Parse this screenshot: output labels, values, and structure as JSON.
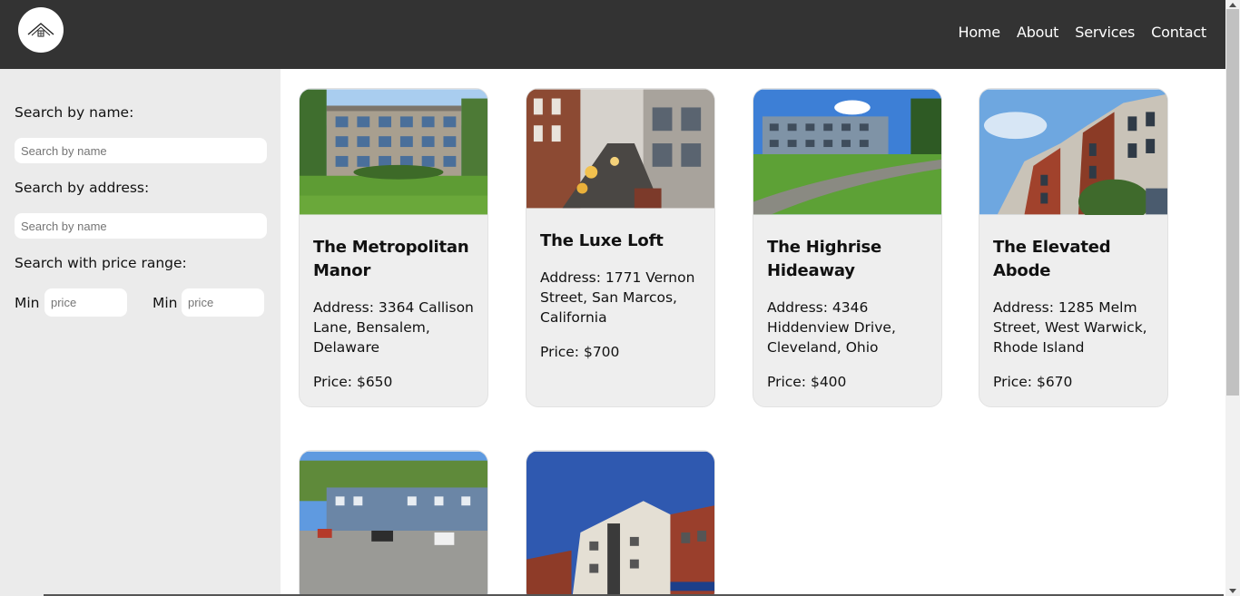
{
  "header": {
    "logo_icon": "house-roof-icon",
    "nav": [
      "Home",
      "About",
      "Services",
      "Contact"
    ]
  },
  "sidebar": {
    "name_label": "Search by name:",
    "name_placeholder": "Search by name",
    "address_label": "Search by address:",
    "address_placeholder": "Search by name",
    "price_label": "Search with price range:",
    "min_label_1": "Min",
    "min_placeholder_1": "price",
    "min_label_2": "Min",
    "min_placeholder_2": "price"
  },
  "listings": [
    {
      "title": "The Metropolitan Manor",
      "address": "Address: 3364 Callison Lane, Bensalem, Delaware",
      "price": "Price: $650",
      "image": "apartment-courtyard-photo"
    },
    {
      "title": "The Luxe Loft",
      "address": "Address: 1771 Vernon Street, San Marcos, California",
      "price": "Price: $700",
      "image": "loft-courtyard-lights-photo"
    },
    {
      "title": "The Highrise Hideaway",
      "address": "Address: 4346 Hiddenview Drive, Cleveland, Ohio",
      "price": "Price: $400",
      "image": "apartment-lawn-path-photo"
    },
    {
      "title": "The Elevated Abode",
      "address": "Address: 1285 Melm Street, West Warwick, Rhode Island",
      "price": "Price: $670",
      "image": "modern-building-sky-photo"
    },
    {
      "title": "",
      "address": "",
      "price": "",
      "image": "apartment-parking-lot-photo"
    },
    {
      "title": "",
      "address": "",
      "price": "",
      "image": "brick-building-fire-escape-photo"
    }
  ],
  "colors": {
    "header_bg": "#333333",
    "sidebar_bg": "#ebebeb",
    "card_bg": "#eeeeee"
  }
}
